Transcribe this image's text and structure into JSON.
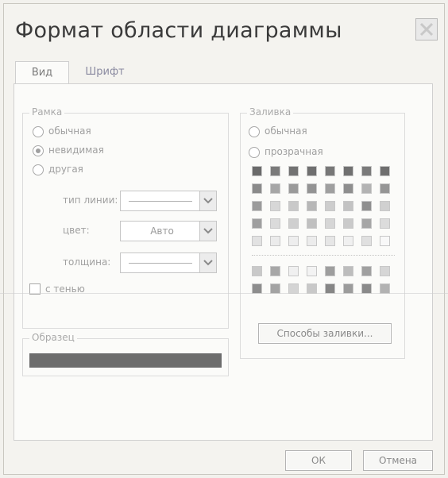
{
  "window": {
    "title": "Формат области диаграммы"
  },
  "tabs": [
    {
      "label": "Вид",
      "active": true
    },
    {
      "label": "Шрифт",
      "active": false
    }
  ],
  "border": {
    "legend": "Рамка",
    "options": [
      {
        "label": "обычная",
        "selected": false
      },
      {
        "label": "невидимая",
        "selected": true
      },
      {
        "label": "другая",
        "selected": false
      }
    ],
    "line_type_label": "тип линии:",
    "color_label": "цвет:",
    "color_value": "Авто",
    "thickness_label": "толщина:",
    "shadow_label": "с тенью"
  },
  "fill": {
    "legend": "Заливка",
    "options": [
      {
        "label": "обычная",
        "selected": false
      },
      {
        "label": "прозрачная",
        "selected": false
      }
    ],
    "effects_button": "Способы заливки..."
  },
  "sample": {
    "legend": "Образец",
    "color": "#6d6d6d"
  },
  "footer": {
    "ok_label": "ОК",
    "cancel_label": "Отмена"
  },
  "palette": {
    "row1": [
      "#6a6a6a",
      "#7a7a7a",
      "#727272",
      "#6f6f6f",
      "#777777",
      "#707070",
      "#7a7a7a",
      "#6e6e6e"
    ],
    "row2": [
      "#8a8a8a",
      "#a6a6a6",
      "#9a9a9a",
      "#939393",
      "#9f9f9f",
      "#8e8e8e",
      "#b3b3b3",
      "#959595"
    ],
    "row3": [
      "#9b9b9b",
      "#d7d7d7",
      "#c9c9c9",
      "#b7b7b7",
      "#cdcdcd",
      "#c3c3c3",
      "#8f8f8f",
      "#d0d0d0"
    ],
    "row4": [
      "#9f9f9f",
      "#dbdbdb",
      "#cfcfcf",
      "#c0c0c0",
      "#d6d6d6",
      "#cacaca",
      "#a6a6a6",
      "#dcdcdc"
    ],
    "row5": [
      "#e2e2e2",
      "#ebebeb",
      "#eeeeee",
      "#ececec",
      "#e6e6e6",
      "#f0f0f0",
      "#e0e0e0",
      "#f8f8f8"
    ],
    "row6": [
      "#c9c9c9",
      "#a7a7a7",
      "#f0f0f0",
      "#f3f3f3",
      "#9e9e9e",
      "#bdbdbd",
      "#a0a0a0",
      "#d6d6d6"
    ],
    "row7": [
      "#8d8d8d",
      "#a3a3a3",
      "#d4d4d4",
      "#c8c8c8",
      "#868686",
      "#9c9c9c",
      "#8a8a8a",
      "#b2b2b2"
    ]
  }
}
